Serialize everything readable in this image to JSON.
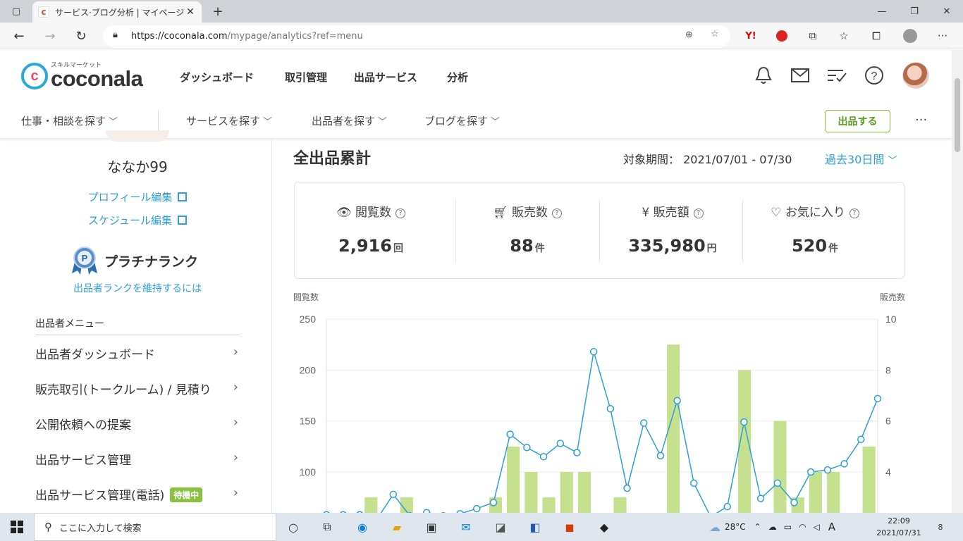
{
  "browser": {
    "tab_title": "サービス·ブログ分析 | マイページ | ココ",
    "url_host": "https://coconala.com",
    "url_path": "/mypage/analytics?ref=menu"
  },
  "header": {
    "logo_text": "coconala",
    "logo_kana": "スキルマーケット",
    "nav": [
      "ダッシュボード",
      "取引管理",
      "出品サービス",
      "分析"
    ]
  },
  "subnav": {
    "items": [
      "仕事・相談を探す",
      "サービスを探す",
      "出品者を探す",
      "ブログを探す"
    ],
    "list_button": "出品する",
    "more": "···"
  },
  "sidebar": {
    "username": "ななか99",
    "profile_edit": "プロフィール編集",
    "schedule_edit": "スケジュール編集",
    "rank": "プラチナランク",
    "rank_link": "出品者ランクを維持するには",
    "menu_heading": "出品者メニュー",
    "menu": [
      "出品者ダッシュボード",
      "販売取引(トークルーム) / 見積り",
      "公開依頼への提案",
      "出品サービス管理",
      "出品サービス管理(電話)"
    ],
    "phone_badge": "待機中"
  },
  "main": {
    "title": "全出品累計",
    "period_label": "対象期間：",
    "period_value": "2021/07/01 - 07/30",
    "period_select": "過去30日間",
    "stats": [
      {
        "label": "閲覧数",
        "value": "2,916",
        "unit": "回",
        "icon": "eye-icon"
      },
      {
        "label": "販売数",
        "value": "88",
        "unit": "件",
        "icon": "cart-icon"
      },
      {
        "label": "販売額",
        "value": "335,980",
        "unit": "円",
        "icon": "yen-icon"
      },
      {
        "label": "お気に入り",
        "value": "520",
        "unit": "件",
        "icon": "heart-icon"
      }
    ]
  },
  "chart_data": {
    "type": "bar",
    "ylabel": "閲覧数",
    "y2label": "販売数",
    "y_ticks": [
      "250",
      "200",
      "150",
      "100"
    ],
    "y2_ticks": [
      "10",
      "8",
      "6",
      "4"
    ],
    "ylim": [
      0,
      250
    ],
    "y2lim": [
      0,
      10
    ],
    "bar_color": "#c5e08e",
    "line_color": "#2aa0d8",
    "series": [
      {
        "name": "閲覧数",
        "type": "line",
        "values": [
          58,
          58,
          58,
          53,
          78,
          57,
          60,
          57,
          59,
          64,
          70,
          137,
          124,
          115,
          128,
          119,
          218,
          162,
          84,
          148,
          116,
          170,
          89,
          56,
          66,
          149,
          74,
          89,
          70,
          100,
          102,
          108,
          132,
          172
        ]
      },
      {
        "name": "販売数",
        "type": "bar",
        "values": [
          0,
          0,
          3,
          0,
          3,
          0,
          0,
          0,
          0,
          3,
          5,
          4,
          3,
          4,
          4,
          0,
          3,
          0,
          0,
          9,
          0,
          0,
          0,
          8,
          0,
          6,
          3,
          4,
          4,
          0,
          5
        ]
      }
    ]
  },
  "taskbar": {
    "search_placeholder": "ここに入力して検索",
    "weather": "28°C",
    "ime": "A",
    "time": "22:09",
    "date": "2021/07/31",
    "notifications": "8"
  }
}
